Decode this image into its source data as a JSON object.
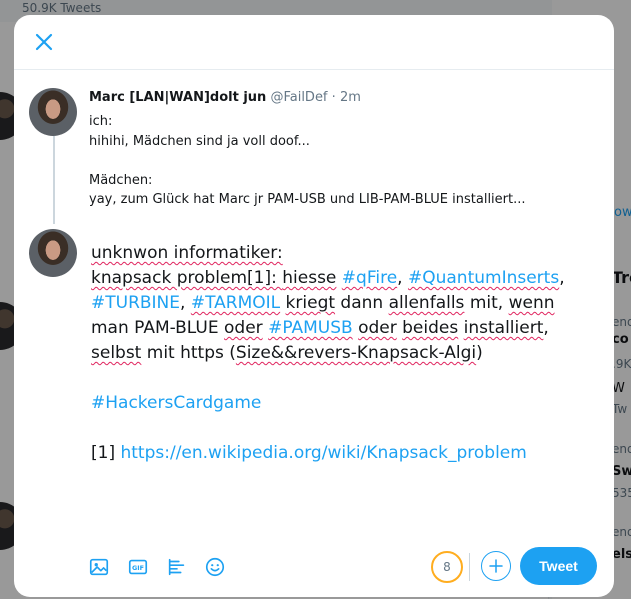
{
  "background": {
    "header_tweets_count": "50.9K Tweets",
    "right_fragments": [
      "ow",
      "Tre",
      "end",
      "co",
      ".9K",
      "W",
      "Tw",
      "end",
      "Swi",
      "535",
      "end",
      "else"
    ]
  },
  "modal": {
    "close_icon": "close-icon",
    "original_tweet": {
      "author_name": "Marc [LAN|WAN]dolt jun",
      "author_handle": "@FailDef",
      "separator": "·",
      "time": "2m",
      "lines": [
        "ich:",
        "hihihi, Mädchen sind ja voll doof...",
        "",
        "Mädchen:",
        "yay, zum Glück hat Marc jr PAM-USB und LIB-PAM-BLUE installiert..."
      ]
    },
    "reply": {
      "l1": "unknwon informatiker:",
      "l2_a": "knapsack problem[1]: ",
      "l2_b": "hiesse",
      "l2_c": " ",
      "l2_d": "#qFire",
      "l2_e": ", ",
      "l2_f": "#QuantumInserts",
      "l2_g": ",",
      "l3_a": "#TURBINE",
      "l3_b": ", ",
      "l3_c": "#TARMOIL",
      "l3_d": " ",
      "l3_e": "kriegt",
      "l3_f": " dann ",
      "l3_g": "allenfalls",
      "l3_h": " mit, ",
      "l3_i": "wenn",
      "l4_a": "man PAM-BLUE ",
      "l4_b": "oder",
      "l4_c": " ",
      "l4_d": "#PAMUSB",
      "l4_e": " ",
      "l4_f": "oder",
      "l4_g": " ",
      "l4_h": "beides",
      "l4_i": " ",
      "l4_j": "installiert",
      "l4_k": ",",
      "l5_a": "selbst",
      "l5_b": " mit https (",
      "l5_c": "Size&&revers-Knapsack-Algi",
      "l5_d": ")",
      "l6": "#HackersCardgame",
      "l7_a": "[1] ",
      "l7_b": "https://en.wikipedia.org/wiki/Knapsack_problem"
    },
    "toolbar": {
      "icons": [
        "image-icon",
        "gif-icon",
        "poll-icon",
        "emoji-icon"
      ],
      "counter": "8",
      "tweet_label": "Tweet"
    }
  }
}
